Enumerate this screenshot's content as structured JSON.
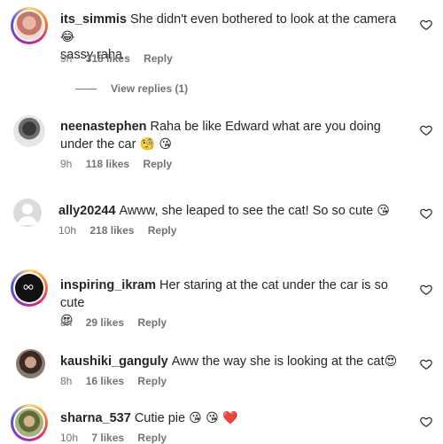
{
  "comments": [
    {
      "username": "its_simmis",
      "text": "She didn't even bothered to look at the camera",
      "emoji": "😂",
      "text2": "sassy raha",
      "time": "9h",
      "likes": "318 likes",
      "reply": "Reply"
    },
    {
      "username": "neenastephen",
      "text": "Raha be like Edward what are you doing under the car",
      "emoji": "🧐 😘",
      "time": "9h",
      "likes": "118 likes",
      "reply": "Reply"
    },
    {
      "username": "ally20244",
      "text": "Awww, she leaped to see the cat! So so cute",
      "emoji": "😘",
      "time": "10h",
      "likes": "218 likes",
      "reply": "Reply"
    },
    {
      "username": "inspiring_ikram",
      "text": "Her staring at the cat under the car is so cute",
      "emoji": "😍",
      "time": "8h",
      "likes": "29 likes",
      "reply": "Reply"
    },
    {
      "username": "kaushiki_ganguly",
      "text": "Aww the way she is looking at the cat",
      "emoji": "😍",
      "time": "8h",
      "likes": "16 likes",
      "reply": "Reply"
    },
    {
      "username": "sharna_537",
      "text": "Cutie pie",
      "emoji": "😘 😘 ❤️",
      "time": "10h",
      "likes": "7 likes",
      "reply": "Reply"
    }
  ],
  "view_replies": "View replies (1)",
  "colors": {
    "text": "#262626",
    "muted": "#737373",
    "heart_red": "#e0245e"
  }
}
